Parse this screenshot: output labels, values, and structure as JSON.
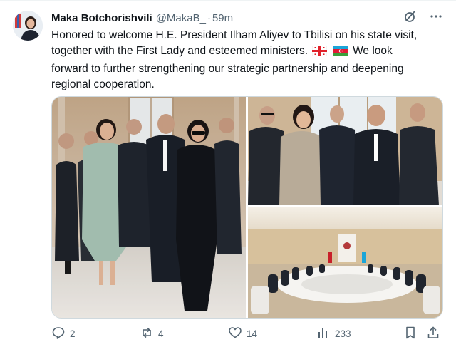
{
  "author": {
    "name": "Maka Botchorishvili",
    "handle": "@MakaB_",
    "separator": "·",
    "time": "59m"
  },
  "post": {
    "line1": "Honored to welcome H.E. President Ilham Aliyev to Tbilisi on his state visit,",
    "line2a": "together with the First Lady and esteemed ministers.",
    "line2b": "We look",
    "line3": "forward to further strengthening our strategic partnership and deepening",
    "line4": "regional cooperation.",
    "flags": [
      "georgia-flag",
      "azerbaijan-flag"
    ]
  },
  "media": {
    "photos": [
      "delegation-walking-photo",
      "delegation-standing-photo",
      "conference-table-photo"
    ]
  },
  "actions": {
    "replies": "2",
    "reposts": "4",
    "likes": "14",
    "views": "233"
  },
  "colors": {
    "text": "#0f1419",
    "muted": "#536471",
    "border": "#cfd9de"
  }
}
